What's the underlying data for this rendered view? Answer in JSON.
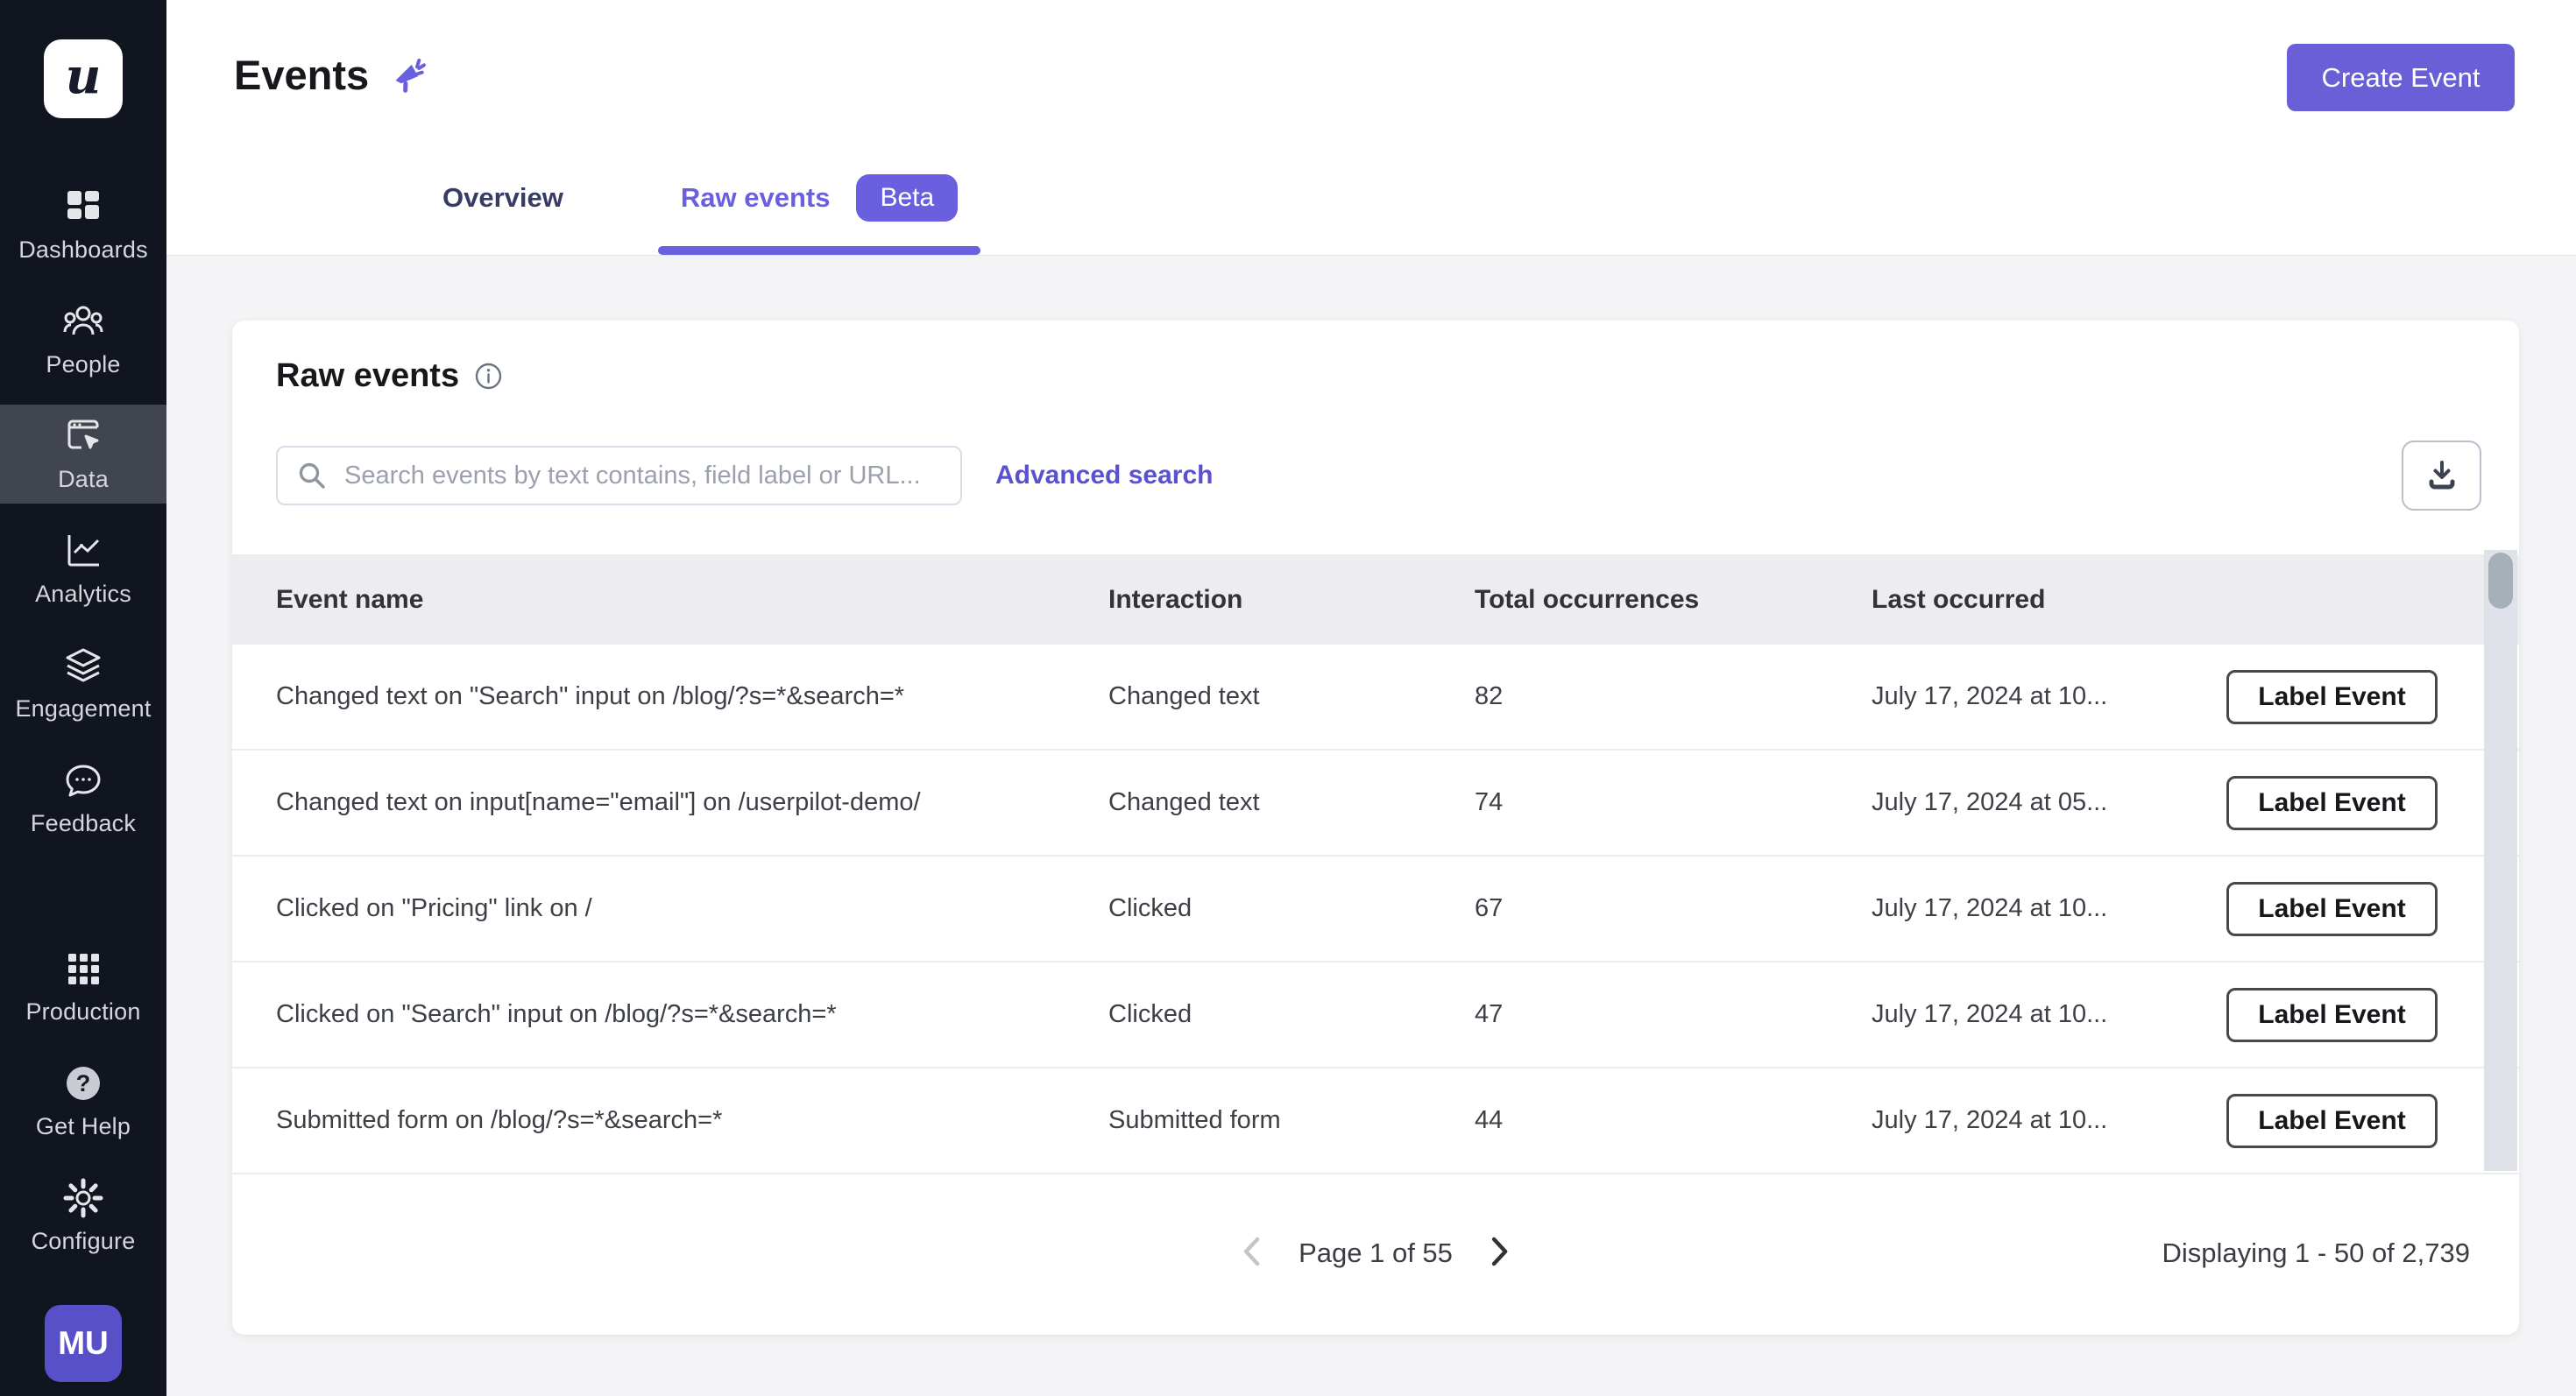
{
  "colors": {
    "accent_purple": "#6a5fde",
    "button_purple": "#6a5fd6",
    "sidebar_bg": "#11151f",
    "sidebar_active_bg": "#41454f",
    "page_bg": "#f4f4f6",
    "table_header_bg": "#ededef",
    "avatar_bg": "#5750c9"
  },
  "sidebar": {
    "logo_text": "u",
    "items": [
      {
        "label": "Dashboards",
        "icon": "dashboards",
        "active": false,
        "group": "top"
      },
      {
        "label": "People",
        "icon": "people",
        "active": false,
        "group": "top"
      },
      {
        "label": "Data",
        "icon": "data",
        "active": true,
        "group": "top"
      },
      {
        "label": "Analytics",
        "icon": "analytics",
        "active": false,
        "group": "top"
      },
      {
        "label": "Engagement",
        "icon": "engagement",
        "active": false,
        "group": "top"
      },
      {
        "label": "Feedback",
        "icon": "feedback",
        "active": false,
        "group": "top"
      },
      {
        "label": "Production",
        "icon": "production",
        "active": false,
        "group": "bottom"
      },
      {
        "label": "Get Help",
        "icon": "get-help",
        "active": false,
        "group": "bottom"
      },
      {
        "label": "Configure",
        "icon": "configure",
        "active": false,
        "group": "bottom"
      }
    ],
    "avatar_initials": "MU"
  },
  "header": {
    "title": "Events",
    "title_icon": "megaphone-icon",
    "create_button_label": "Create Event",
    "tabs": [
      {
        "label": "Overview",
        "active": false
      },
      {
        "label": "Raw events",
        "badge": "Beta",
        "active": true
      }
    ]
  },
  "card": {
    "title": "Raw events",
    "info_icon": "info-icon",
    "search_placeholder": "Search events by text contains, field label or URL...",
    "search_value": "",
    "advanced_search_label": "Advanced search",
    "download_icon": "download-icon"
  },
  "table": {
    "columns": [
      "Event name",
      "Interaction",
      "Total occurrences",
      "Last occurred"
    ],
    "rows": [
      {
        "event_name": "Changed text on \"Search\" input on /blog/?s=*&search=*",
        "interaction": "Changed text",
        "total": "82",
        "last_occurred": "July 17, 2024 at 10...",
        "action": "Label Event"
      },
      {
        "event_name": "Changed text on input[name=\"email\"] on /userpilot-demo/",
        "interaction": "Changed text",
        "total": "74",
        "last_occurred": "July 17, 2024 at 05...",
        "action": "Label Event"
      },
      {
        "event_name": "Clicked on \"Pricing\" link on /",
        "interaction": "Clicked",
        "total": "67",
        "last_occurred": "July 17, 2024 at 10...",
        "action": "Label Event"
      },
      {
        "event_name": "Clicked on \"Search\" input on /blog/?s=*&search=*",
        "interaction": "Clicked",
        "total": "47",
        "last_occurred": "July 17, 2024 at 10...",
        "action": "Label Event"
      },
      {
        "event_name": "Submitted form on /blog/?s=*&search=*",
        "interaction": "Submitted form",
        "total": "44",
        "last_occurred": "July 17, 2024 at 10...",
        "action": "Label Event"
      }
    ]
  },
  "pagination": {
    "page_label": "Page 1 of 55",
    "summary": "Displaying 1 - 50 of 2,739"
  }
}
